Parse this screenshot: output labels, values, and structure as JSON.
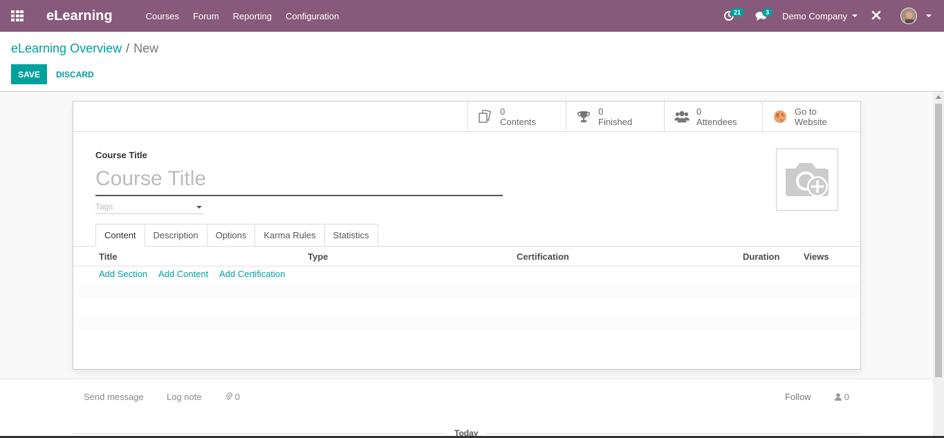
{
  "navbar": {
    "brand": "eLearning",
    "menu": [
      "Courses",
      "Forum",
      "Reporting",
      "Configuration"
    ],
    "activity_count": "21",
    "message_count": "3",
    "company": "Demo Company",
    "bg_color": "#875a7b",
    "icons": [
      "apps-grid-icon",
      "activity-clock-icon",
      "chat-icon",
      "close-x-icon",
      "user-avatar"
    ]
  },
  "breadcrumb": {
    "parent": "eLearning Overview",
    "separator": "/",
    "current": "New"
  },
  "actions": {
    "save": "SAVE",
    "discard": "DISCARD",
    "accent": "#00a09d"
  },
  "stat_buttons": [
    {
      "value": "0",
      "label": "Contents",
      "icon": "documents-icon"
    },
    {
      "value": "0",
      "label": "Finished",
      "icon": "trophy-icon"
    },
    {
      "value": "0",
      "label": "Attendees",
      "icon": "users-icon"
    },
    {
      "value": "Go to",
      "label": "Website",
      "icon": "globe-icon"
    }
  ],
  "form": {
    "title_label": "Course Title",
    "title_placeholder": "Course Title",
    "tags_placeholder": "Tags"
  },
  "tabs": [
    "Content",
    "Description",
    "Options",
    "Karma Rules",
    "Statistics"
  ],
  "active_tab": "Content",
  "columns": [
    "Title",
    "Type",
    "Certification",
    "Duration",
    "Views"
  ],
  "add_links": [
    "Add Section",
    "Add Content",
    "Add Certification"
  ],
  "chatter": {
    "send_message": "Send message",
    "log_note": "Log note",
    "attachments": "0",
    "follow": "Follow",
    "followers": "0",
    "today": "Today"
  }
}
